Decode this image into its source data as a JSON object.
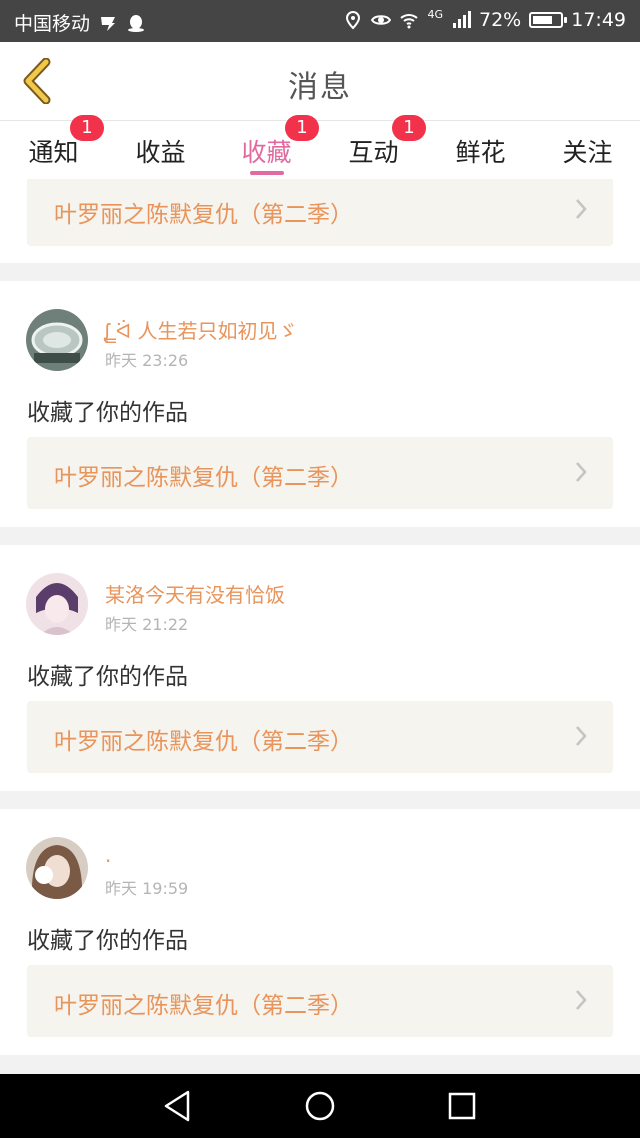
{
  "status_bar": {
    "carrier": "中国移动",
    "network": "4G",
    "battery": "72%",
    "battery_level": 0.72,
    "time": "17:49"
  },
  "header": {
    "title": "消息",
    "back_icon": "chevron-left-icon"
  },
  "tabs": [
    {
      "label": "通知",
      "badge": "1"
    },
    {
      "label": "收益",
      "badge": ""
    },
    {
      "label": "收藏",
      "badge": "1",
      "active": true
    },
    {
      "label": "互动",
      "badge": "1"
    },
    {
      "label": "鲜花",
      "badge": ""
    },
    {
      "label": "关注",
      "badge": ""
    }
  ],
  "feed": {
    "top_partial": {
      "work_title": "叶罗丽之陈默复仇（第二季）"
    },
    "items": [
      {
        "username": "ᶘ ̳ᐛ 人生若只如初见ゞ",
        "time": "昨天 23:26",
        "action": "收藏了你的作品",
        "work_title": "叶罗丽之陈默复仇（第二季）"
      },
      {
        "username": "某洛今天有没有恰饭",
        "time": "昨天 21:22",
        "action": "收藏了你的作品",
        "work_title": "叶罗丽之陈默复仇（第二季）"
      },
      {
        "username": ".",
        "time": "昨天 19:59",
        "action": "收藏了你的作品",
        "work_title": "叶罗丽之陈默复仇（第二季）"
      }
    ]
  },
  "colors": {
    "accent_pink": "#e16ba0",
    "badge_red": "#f2314b",
    "work_orange": "#e8945a",
    "back_yellow": "#f2c84b"
  }
}
